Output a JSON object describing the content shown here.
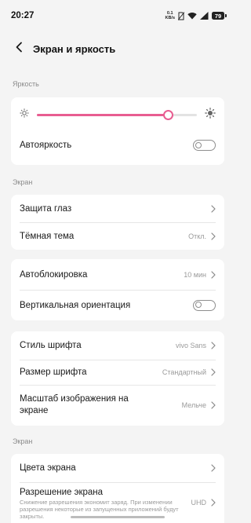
{
  "status_bar": {
    "time": "20:27",
    "net_speed_value": "0.1",
    "net_speed_unit": "KB/s",
    "battery": "79"
  },
  "header": {
    "title": "Экран и яркость",
    "back_icon": "arrow-left-icon"
  },
  "brightness": {
    "section_label": "Яркость",
    "level_percent": 82,
    "auto_label": "Автояркость",
    "auto_enabled": false
  },
  "screen_section": {
    "label": "Экран",
    "eye_protection": "Защита глаз",
    "dark_theme": "Тёмная тема",
    "dark_theme_value": "Откл."
  },
  "lock_section": {
    "auto_lock": "Автоблокировка",
    "auto_lock_value": "10 мин",
    "vertical_orientation": "Вертикальная ориентация",
    "vertical_orientation_enabled": false
  },
  "font_section": {
    "font_style": "Стиль шрифта",
    "font_style_value": "vivo Sans",
    "font_size": "Размер шрифта",
    "font_size_value": "Стандартный",
    "display_scale": "Масштаб изображения на экране",
    "display_scale_value": "Мельче"
  },
  "screen_section_2": {
    "label": "Экран",
    "screen_colors": "Цвета экрана",
    "resolution": "Разрешение экрана",
    "resolution_desc": "Снижение разрешения экономит заряд. При изменении разрешения некоторые из запущенных приложений будут закрыты.",
    "resolution_value": "UHD"
  },
  "colors": {
    "accent": "#e85d91",
    "background": "#f4f4f4",
    "card": "#ffffff"
  }
}
